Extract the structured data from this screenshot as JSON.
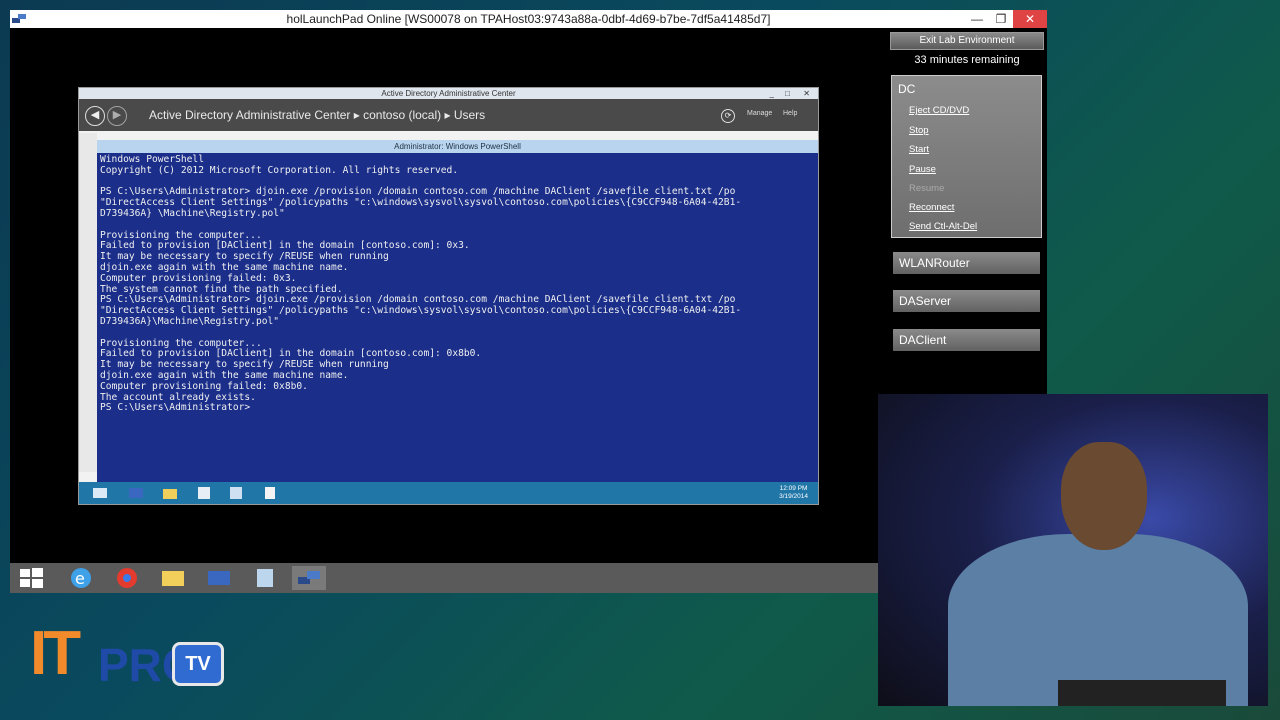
{
  "outer_window": {
    "title": "holLaunchPad Online  [WS00078 on TPAHost03:9743a88a-0dbf-4d69-b7be-7df5a41485d7]",
    "minimize": "—",
    "maximize": "❐",
    "close": "✕"
  },
  "adac": {
    "title": "Active Directory Administrative Center",
    "breadcrumb": "Active Directory Administrative Center  ▸  contoso (local)  ▸  Users",
    "manage_label": "Manage",
    "help_label": "Help",
    "min": "_",
    "max": "□",
    "close": "✕"
  },
  "powershell": {
    "title": "Administrator: Windows PowerShell",
    "lines": [
      "Windows PowerShell",
      "Copyright (C) 2012 Microsoft Corporation. All rights reserved.",
      "",
      "PS C:\\Users\\Administrator> djoin.exe /provision /domain contoso.com /machine DAClient /savefile client.txt /po",
      "\"DirectAccess Client Settings\" /policypaths \"c:\\windows\\sysvol\\sysvol\\contoso.com\\policies\\{C9CCF948-6A04-42B1-",
      "D739436A} \\Machine\\Registry.pol\"",
      "",
      "Provisioning the computer...",
      "Failed to provision [DAClient] in the domain [contoso.com]: 0x3.",
      "It may be necessary to specify /REUSE when running",
      "djoin.exe again with the same machine name.",
      "Computer provisioning failed: 0x3.",
      "The system cannot find the path specified.",
      "PS C:\\Users\\Administrator> djoin.exe /provision /domain contoso.com /machine DAClient /savefile client.txt /po",
      "\"DirectAccess Client Settings\" /policypaths \"c:\\windows\\sysvol\\sysvol\\contoso.com\\policies\\{C9CCF948-6A04-42B1-",
      "D739436A}\\Machine\\Registry.pol\"",
      "",
      "Provisioning the computer...",
      "Failed to provision [DAClient] in the domain [contoso.com]: 0x8b0.",
      "It may be necessary to specify /REUSE when running",
      "djoin.exe again with the same machine name.",
      "Computer provisioning failed: 0x8b0.",
      "The account already exists.",
      "PS C:\\Users\\Administrator>"
    ]
  },
  "inner_taskbar": {
    "time": "12:09 PM",
    "date": "3/19/2014"
  },
  "panel": {
    "exit_label": "Exit Lab Environment",
    "time_remaining": "33 minutes remaining",
    "active_vm": {
      "name": "DC",
      "actions": [
        "Eject CD/DVD",
        "Stop",
        "Start",
        "Pause",
        "Resume",
        "Reconnect",
        "Send Ctl-Alt-Del"
      ]
    },
    "vms": [
      "WLANRouter",
      "DAServer",
      "DAClient"
    ]
  },
  "logo": {
    "it": "IT",
    "pro": "PRO",
    "tv": "TV"
  },
  "colors": {
    "powershell_bg": "#1a2e8a",
    "inner_taskbar": "#2176a8",
    "logo_orange": "#f08a2b",
    "logo_blue": "#1f4aa8"
  }
}
